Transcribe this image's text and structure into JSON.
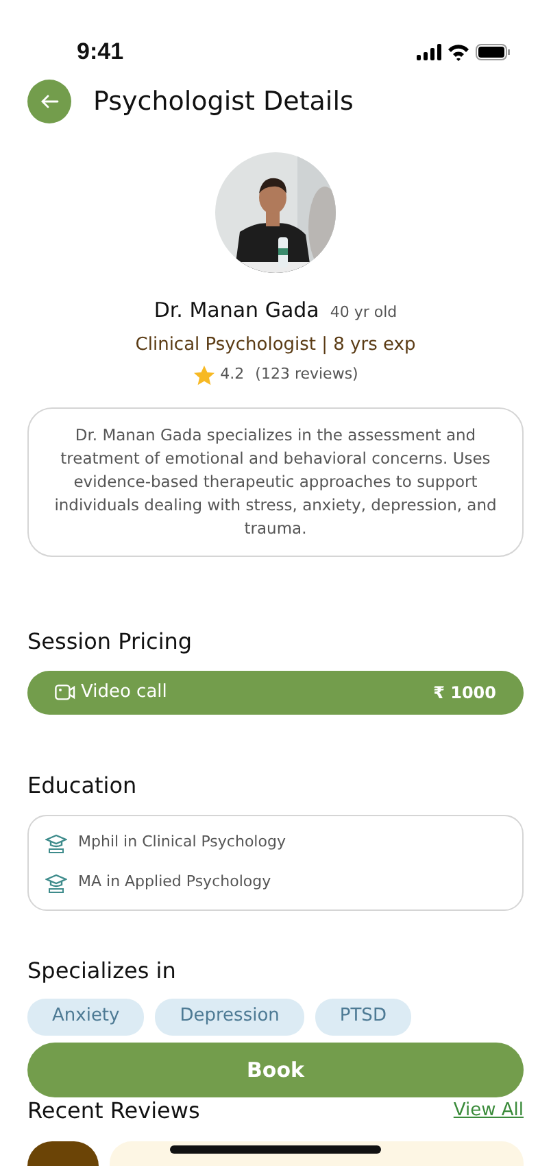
{
  "status_bar": {
    "time": "9:41"
  },
  "header": {
    "title": "Psychologist Details"
  },
  "profile": {
    "name": "Dr. Manan Gada",
    "age": "40 yr old",
    "title": "Clinical Psychologist | 8 yrs exp",
    "rating": "4.2",
    "reviews": "(123 reviews)"
  },
  "bio": "Dr. Manan Gada specializes in the assessment and treatment of emotional and behavioral concerns. Uses evidence-based therapeutic approaches to support individuals dealing with stress, anxiety, depression, and trauma.",
  "session_pricing": {
    "heading": "Session Pricing",
    "options": [
      {
        "kind": "video",
        "label": "Video call",
        "price": "₹ 1000"
      }
    ]
  },
  "education": {
    "heading": "Education",
    "items": [
      "Mphil in Clinical Psychology",
      "MA in Applied Psychology"
    ]
  },
  "specializations": {
    "heading": "Specializes in",
    "tags": [
      "Anxiety",
      "Depression",
      "PTSD"
    ]
  },
  "book_button": "Book",
  "reviews": {
    "heading": "Recent Reviews",
    "view_all": "View All"
  }
}
